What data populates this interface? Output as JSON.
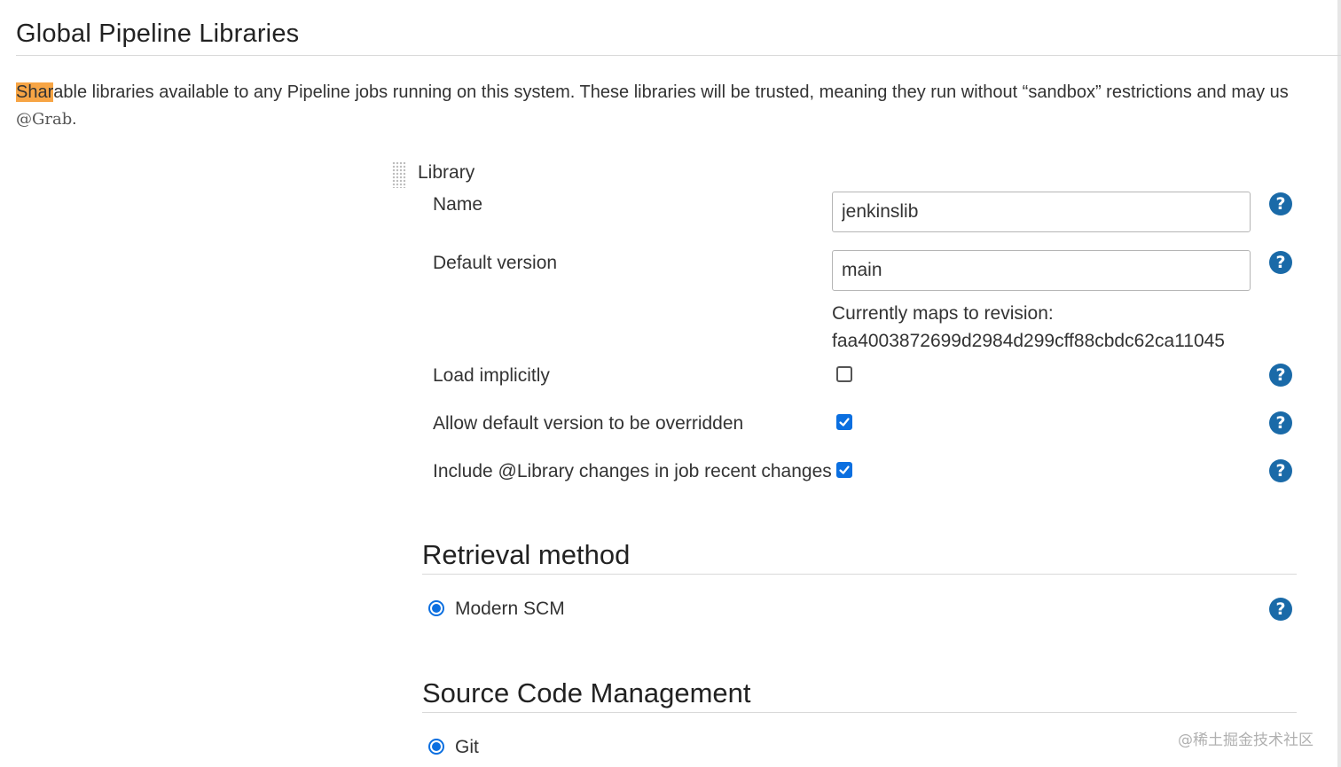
{
  "page": {
    "title": "Global Pipeline Libraries",
    "description_highlight": "Shar",
    "description_rest": "able libraries available to any Pipeline jobs running on this system. These libraries will be trusted, meaning they run without “sandbox” restrictions and may us",
    "grab_code": "@Grab",
    "grab_suffix": "."
  },
  "library": {
    "header": "Library",
    "name_label": "Name",
    "name_value": "jenkinslib",
    "default_version_label": "Default version",
    "default_version_value": "main",
    "revision_line1": "Currently maps to revision:",
    "revision_line2": "faa4003872699d2984d299cff88cbdc62ca11045",
    "load_implicitly_label": "Load implicitly",
    "load_implicitly_checked": false,
    "allow_override_label": "Allow default version to be overridden",
    "allow_override_checked": true,
    "include_changes_label": "Include @Library changes in job recent changes",
    "include_changes_checked": true
  },
  "retrieval": {
    "title": "Retrieval method",
    "option_label": "Modern SCM",
    "option_selected": true
  },
  "scm": {
    "title": "Source Code Management",
    "option_label": "Git",
    "option_selected": true
  },
  "help_glyph": "?",
  "watermark": "@稀土掘金技术社区",
  "colors": {
    "highlight": "#f7a545",
    "help_icon": "#1a6aa8",
    "checkbox_checked": "#0b6fe0"
  }
}
